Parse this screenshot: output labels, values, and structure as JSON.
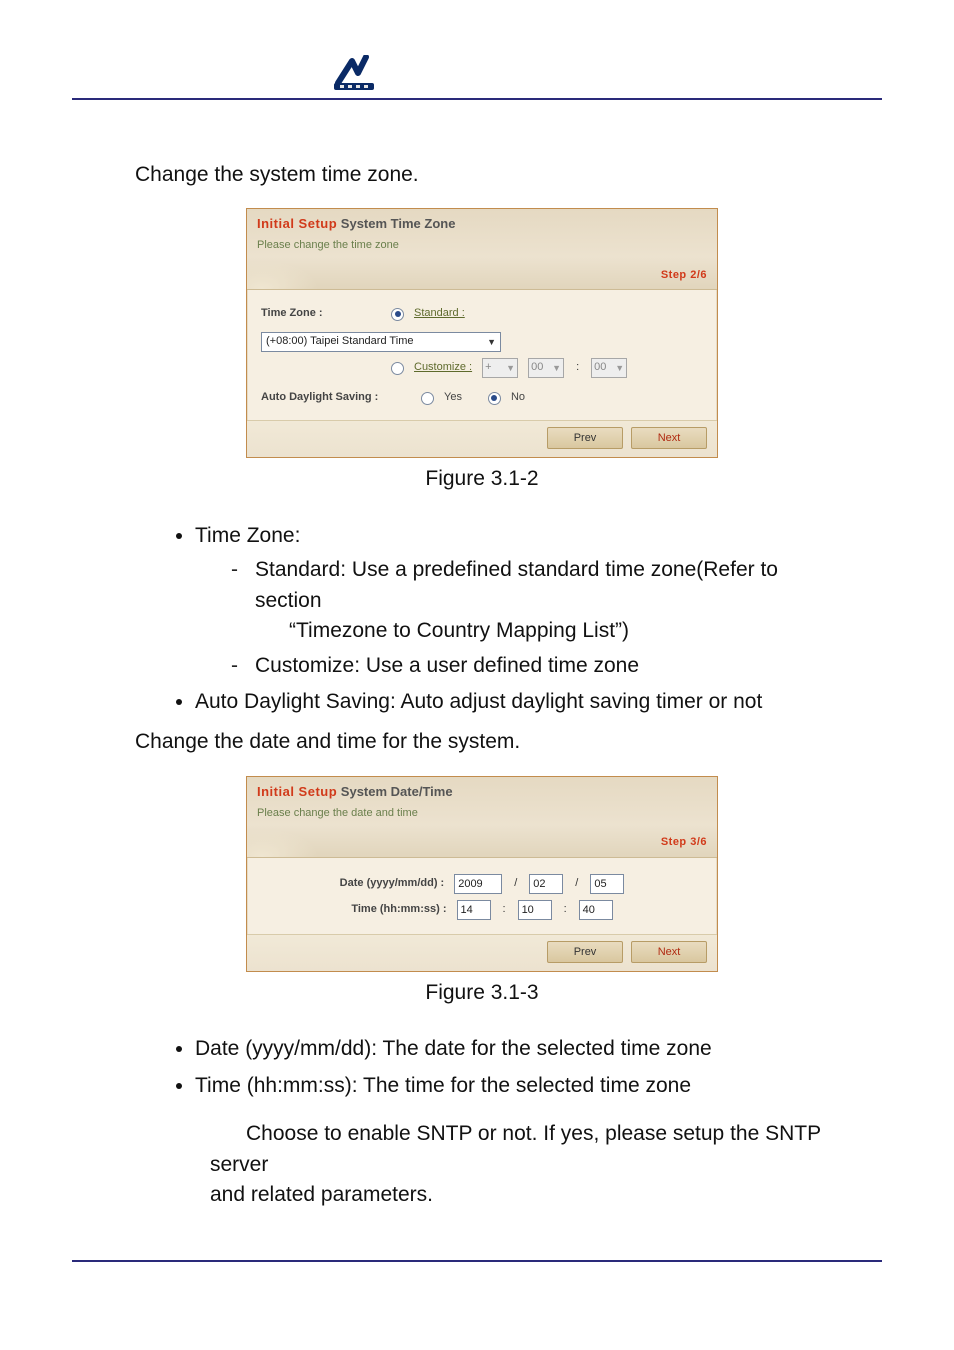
{
  "intro_line": "Change the system time zone.",
  "dialog_tz": {
    "title_accent": "Initial Setup",
    "title_rest": "System Time Zone",
    "sub": "Please change the time zone",
    "step": "Step 2/6",
    "label_timezone": "Time Zone :",
    "label_standard": "Standard :",
    "standard_value": "(+08:00) Taipei Standard Time",
    "label_customize": "Customize :",
    "cust_sign": "+",
    "cust_hh": "00",
    "cust_mm": "00",
    "label_adls": "Auto Daylight Saving :",
    "opt_yes": "Yes",
    "opt_no": "No",
    "btn_prev": "Prev",
    "btn_next": "Next"
  },
  "figcap_1": "Figure 3.1-2",
  "bullets_a": {
    "tz_heading": "Time Zone:",
    "std_line1": "Standard: Use a predefined standard time zone(Refer to section",
    "std_line2": "“Timezone to Country Mapping List”)",
    "customize": "Customize: Use a user defined time zone",
    "adls": "Auto Daylight Saving: Auto adjust daylight saving timer or not"
  },
  "change_dt_line": "Change the date and time for the system.",
  "dialog_dt": {
    "title_accent": "Initial Setup",
    "title_rest": "System Date/Time",
    "sub": "Please change the date and time",
    "step": "Step 3/6",
    "label_date": "Date (yyyy/mm/dd) :",
    "date_y": "2009",
    "date_m": "02",
    "date_d": "05",
    "label_time": "Time (hh:mm:ss) :",
    "time_h": "14",
    "time_m": "10",
    "time_s": "40",
    "btn_prev": "Prev",
    "btn_next": "Next"
  },
  "figcap_2": "Figure 3.1-3",
  "bullets_b": {
    "date": "Date (yyyy/mm/dd): The date for the selected time zone",
    "time": "Time (hh:mm:ss): The time for the selected time zone"
  },
  "sntp_line1": "Choose to enable SNTP or not. If yes, please setup the SNTP server",
  "sntp_line2": "and related parameters."
}
